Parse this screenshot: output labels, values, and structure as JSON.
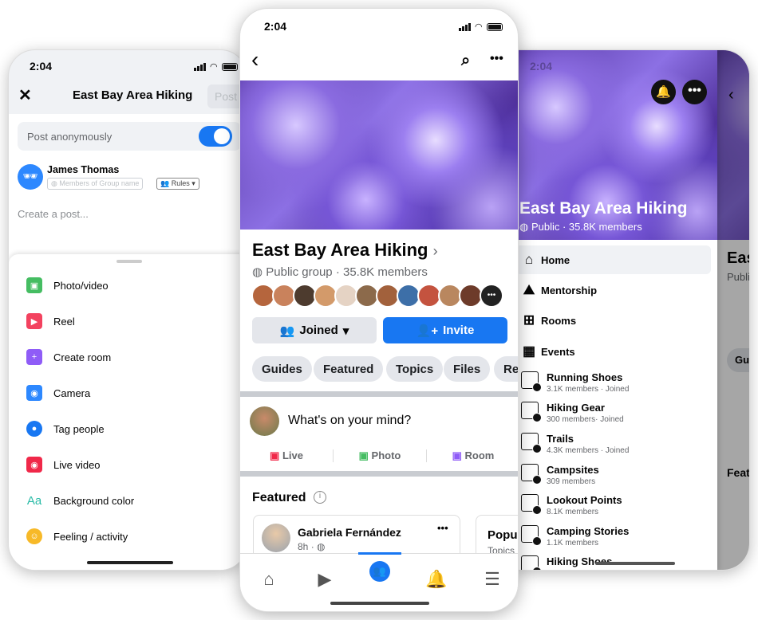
{
  "left_phone": {
    "time": "2:04",
    "header": {
      "close_icon": "close-icon",
      "title": "East Bay Area Hiking",
      "post_label": "Post"
    },
    "anonymous": {
      "label": "Post anonymously",
      "enabled": true
    },
    "author": {
      "name": "James Thomas",
      "audience": "Members of Group name",
      "rules": "Rules"
    },
    "composer_placeholder": "Create a post...",
    "sheet_items": [
      {
        "label": "Photo/video",
        "icon": "photo-icon",
        "color": "#45bd62"
      },
      {
        "label": "Reel",
        "icon": "reel-icon",
        "color": "#f3425f"
      },
      {
        "label": "Create room",
        "icon": "video-room-icon",
        "color": "#8f5cf7"
      },
      {
        "label": "Camera",
        "icon": "camera-icon",
        "color": "#2d88ff"
      },
      {
        "label": "Tag people",
        "icon": "tag-people-icon",
        "color": "#1877f2"
      },
      {
        "label": "Live video",
        "icon": "live-icon",
        "color": "#f02849"
      },
      {
        "label": "Background color",
        "icon": "text-aa-icon",
        "color": "#2abba7"
      },
      {
        "label": "Feeling / activity",
        "icon": "smiley-icon",
        "color": "#f7b928"
      }
    ]
  },
  "center_phone": {
    "time": "2:04",
    "group": {
      "title": "East Bay Area Hiking",
      "meta": "Public group · 35.8K members"
    },
    "buttons": {
      "joined": "Joined",
      "invite": "Invite"
    },
    "chips": [
      "Guides",
      "Featured",
      "Topics",
      "Files",
      "Recent"
    ],
    "composer": {
      "placeholder": "What's on your mind?",
      "live": "Live",
      "photo": "Photo",
      "room": "Room"
    },
    "featured": {
      "title": "Featured",
      "author": "Gabriela Fernández",
      "time": "8h",
      "side_title": "Popular",
      "side_sub": "Topics"
    },
    "bottom_nav": [
      "home-icon",
      "watch-icon",
      "groups-icon",
      "notifications-icon",
      "menu-icon"
    ],
    "accent": "#1877f2"
  },
  "right_phone": {
    "time": "2:04",
    "group": {
      "title": "East Bay Area Hiking",
      "meta": "Public · 35.8K members"
    },
    "menu": [
      "Home",
      "Mentorship",
      "Rooms",
      "Events"
    ],
    "groups": [
      {
        "name": "Running Shoes",
        "sub": "3.1K members · Joined"
      },
      {
        "name": "Hiking Gear",
        "sub": "300 members· Joined"
      },
      {
        "name": "Trails",
        "sub": "4.3K members · Joined"
      },
      {
        "name": "Campsites",
        "sub": "309 members"
      },
      {
        "name": "Lookout Points",
        "sub": "8.1K members"
      },
      {
        "name": "Camping Stories",
        "sub": "1.1K members"
      },
      {
        "name": "Hiking Shoes",
        "sub": ""
      }
    ],
    "behind": {
      "title": "East Bay Area Hiking",
      "meta": "Public group",
      "chip": "Guides",
      "featured": "Featured"
    }
  }
}
